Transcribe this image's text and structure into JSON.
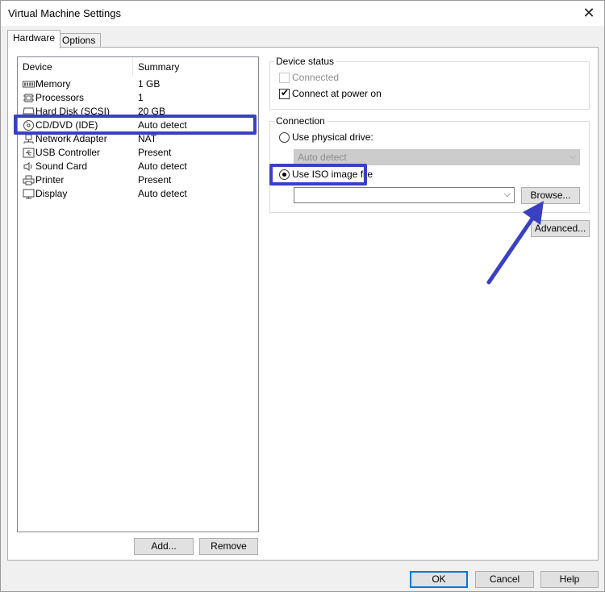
{
  "window": {
    "title": "Virtual Machine Settings",
    "close_glyph": "✕"
  },
  "tabs": [
    {
      "label": "Hardware"
    },
    {
      "label": "Options"
    }
  ],
  "device_list": {
    "columns": {
      "device": "Device",
      "summary": "Summary"
    },
    "rows": [
      {
        "icon": "memory-icon",
        "device": "Memory",
        "summary": "1 GB"
      },
      {
        "icon": "processor-icon",
        "device": "Processors",
        "summary": "1"
      },
      {
        "icon": "hard-disk-icon",
        "device": "Hard Disk (SCSI)",
        "summary": "20 GB"
      },
      {
        "icon": "cd-dvd-icon",
        "device": "CD/DVD (IDE)",
        "summary": "Auto detect",
        "selected": true
      },
      {
        "icon": "network-adapter-icon",
        "device": "Network Adapter",
        "summary": "NAT"
      },
      {
        "icon": "usb-controller-icon",
        "device": "USB Controller",
        "summary": "Present"
      },
      {
        "icon": "sound-card-icon",
        "device": "Sound Card",
        "summary": "Auto detect"
      },
      {
        "icon": "printer-icon",
        "device": "Printer",
        "summary": "Present"
      },
      {
        "icon": "display-icon",
        "device": "Display",
        "summary": "Auto detect"
      }
    ]
  },
  "list_buttons": {
    "add": "Add...",
    "remove": "Remove"
  },
  "device_status": {
    "title": "Device status",
    "connected": {
      "label": "Connected",
      "checked": false,
      "enabled": false
    },
    "connect_at_power_on": {
      "label": "Connect at power on",
      "checked": true
    }
  },
  "connection": {
    "title": "Connection",
    "physical_drive": {
      "label": "Use physical drive:",
      "selected": false
    },
    "drive_select": {
      "value": "Auto detect",
      "enabled": false
    },
    "iso_image": {
      "label": "Use ISO image file",
      "selected": true
    },
    "iso_path": {
      "value": ""
    },
    "browse_label": "Browse..."
  },
  "advanced_label": "Advanced...",
  "footer": {
    "ok": "OK",
    "cancel": "Cancel",
    "help": "Help"
  },
  "colors": {
    "highlight": "#3a40c4",
    "accent": "#0078d7"
  }
}
